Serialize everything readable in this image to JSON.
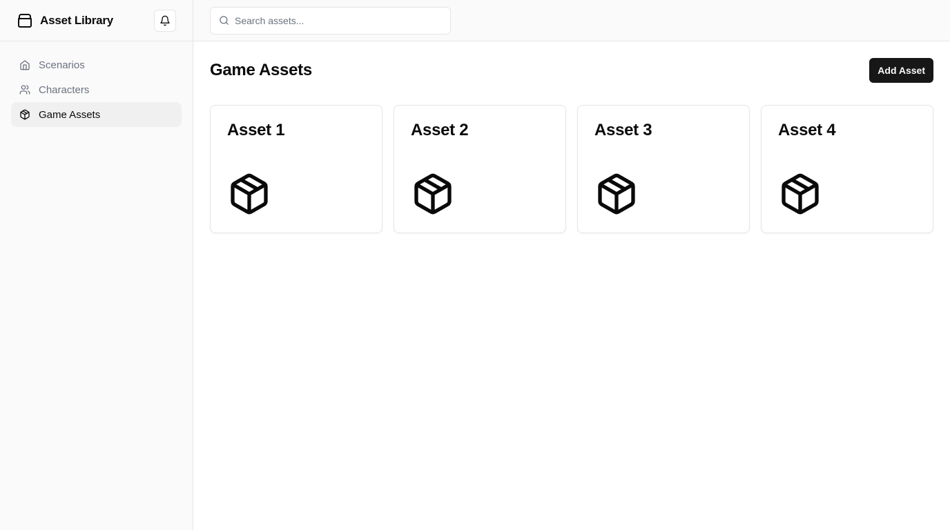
{
  "app": {
    "title": "Asset Library"
  },
  "sidebar": {
    "items": [
      {
        "label": "Scenarios",
        "icon": "home-icon",
        "active": false
      },
      {
        "label": "Characters",
        "icon": "users-icon",
        "active": false
      },
      {
        "label": "Game Assets",
        "icon": "package-icon",
        "active": true
      }
    ]
  },
  "search": {
    "placeholder": "Search assets...",
    "value": ""
  },
  "main": {
    "title": "Game Assets",
    "add_label": "Add Asset",
    "assets": [
      {
        "name": "Asset 1",
        "icon": "package-icon"
      },
      {
        "name": "Asset 2",
        "icon": "package-icon"
      },
      {
        "name": "Asset 3",
        "icon": "package-icon"
      },
      {
        "name": "Asset 4",
        "icon": "package-icon"
      }
    ]
  },
  "colors": {
    "accent": "#171717",
    "sidebar_bg": "#fafafa",
    "active_bg": "#f0f0f1",
    "muted_text": "#6b7280",
    "border": "#e5e5e5"
  }
}
